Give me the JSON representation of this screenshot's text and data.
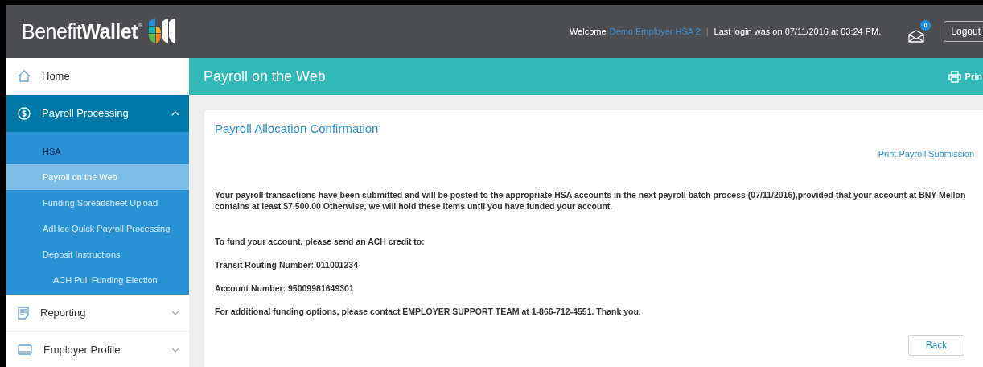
{
  "header": {
    "logo": "Benefit**Wallet**",
    "logo_mark": "®",
    "welcome": "Welcome",
    "user": "Demo Employer HSA 2",
    "separator": "|",
    "last_login": "Last login was on 07/11/2016 at 03:24 PM.",
    "messages_badge": "0",
    "logout": "Logout"
  },
  "sidebar": {
    "items": [
      {
        "label": "Home",
        "selected": false
      },
      {
        "label": "Payroll Processing",
        "selected": true,
        "expanded": true,
        "children": [
          {
            "label": "HSA",
            "kind": "group",
            "selected": false
          },
          {
            "label": "Payroll on the Web",
            "kind": "link",
            "selected": true
          },
          {
            "label": "Funding Spreadsheet Upload",
            "kind": "link",
            "selected": false
          },
          {
            "label": "AdHoc Quick Payroll Processing",
            "kind": "link",
            "selected": false
          },
          {
            "label": "Deposit Instructions",
            "kind": "link",
            "selected": false,
            "children": [
              {
                "label": "ACH Pull Funding Election",
                "kind": "link",
                "selected": false
              }
            ]
          }
        ]
      },
      {
        "label": "Reporting",
        "selected": false,
        "expanded": false
      },
      {
        "label": "Employer Profile",
        "selected": false,
        "expanded": false
      }
    ]
  },
  "page_bar": {
    "title": "Payroll on the Web",
    "print": "Prin"
  },
  "card": {
    "title": "Payroll Allocation Confirmation",
    "print_link": "Print Payroll Submission",
    "paragraphs": [
      "Your payroll transactions have been submitted and will be posted to the appropriate HSA accounts in the next payroll batch process (07/11/2016),provided that your account at BNY Mellon contains at least $7,500.00 Otherwise, we will hold these items until you have funded your account.",
      "To fund your account, please send an ACH credit to:",
      "Transit Routing Number: 011001234",
      "Account Number: 95009981649301",
      "For additional funding options, please contact EMPLOYER SUPPORT TEAM at 1-866-712-4551. Thank you."
    ],
    "back": "Back"
  }
}
